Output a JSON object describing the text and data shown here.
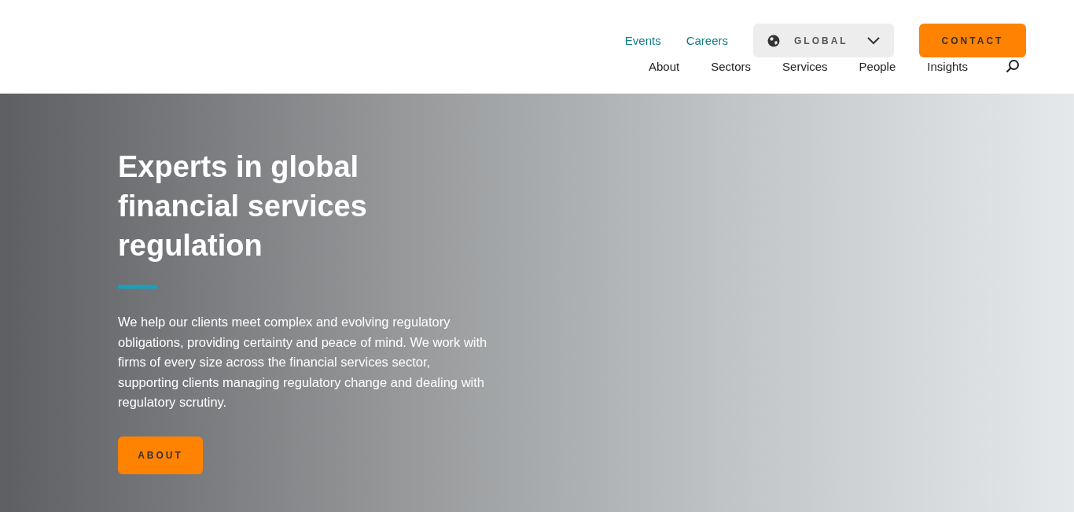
{
  "header": {
    "utility_links": [
      "Events",
      "Careers"
    ],
    "region_selector": {
      "label": "GLOBAL"
    },
    "contact_button": "CONTACT",
    "nav": [
      "About",
      "Sectors",
      "Services",
      "People",
      "Insights"
    ]
  },
  "hero": {
    "title": "Experts in global financial services regulation",
    "description": "We help our clients meet complex and evolving regulatory obligations, providing certainty and peace of mind. We work with firms of every size across the financial services sector, supporting clients managing regulatory change and dealing with regulatory scrutiny.",
    "button": "ABOUT"
  }
}
